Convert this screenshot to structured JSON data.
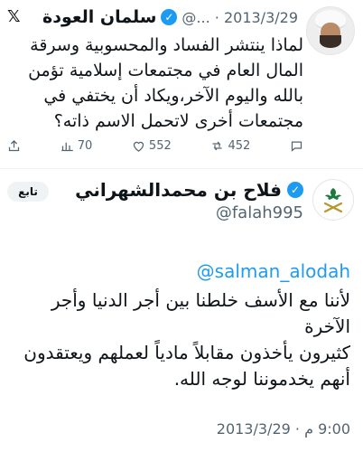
{
  "quoted_tweet": {
    "platform_icon": "x-logo-icon",
    "platform_glyph": "𝕏",
    "author_name": "سلمان العودة",
    "verified_glyph": "✓",
    "handle_truncated": "@...",
    "dot": "·",
    "date": "2013/3/29",
    "text": "لماذا ينتشر الفساد والمحسوبية وسرقة المال العام في مجتمعات إسلامية تؤمن بالله واليوم الآخر،ويكاد أن يختفي في مجتمعات أخرى لاتحمل الاسم ذاته؟",
    "stats": {
      "replies": "",
      "retweets": "452",
      "likes": "552",
      "views": "70"
    }
  },
  "main_tweet": {
    "author_name": "فلاح بن محمدالشهراني",
    "verified_glyph": "✓",
    "handle": "@falah995",
    "follow_label": "تابع",
    "mention": "@salman_alodah",
    "text_line1": "لأننا مع الأسف خلطنا بين أجر الدنيا وأجر الآخرة",
    "text_line2": "كثيرون يأخذون مقابلاً مادياً لعملهم ويعتقدون أنهم يخدموننا لوجه الله.",
    "timestamp": "9:00 م · 2013/3/29"
  },
  "colors": {
    "accent": "#1d9bf0",
    "secondary_text": "#536471",
    "avatar_green": "#1e7a3c"
  }
}
